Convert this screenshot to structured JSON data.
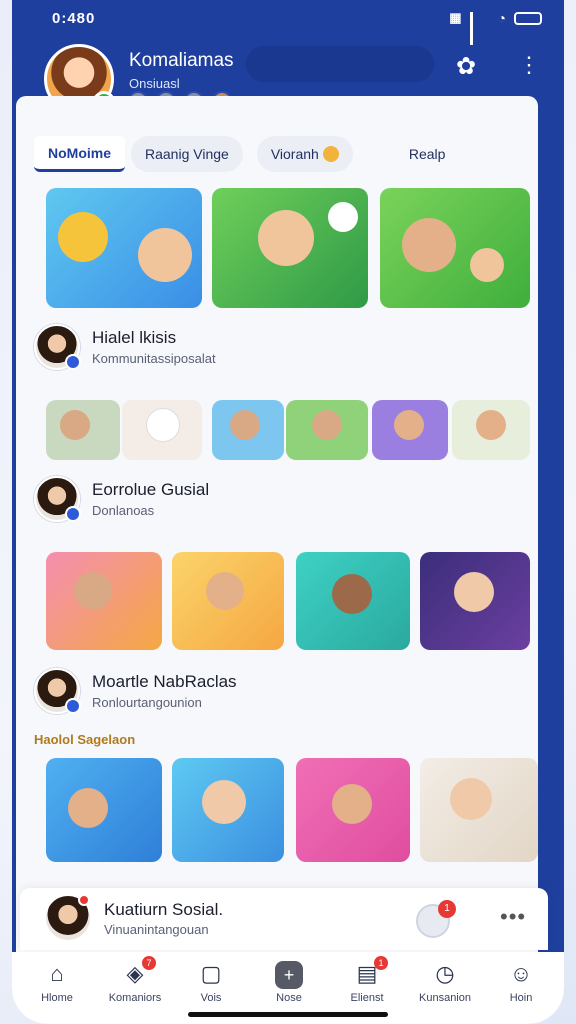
{
  "status_bar": {
    "time": "0:480"
  },
  "header": {
    "title": "Komaliamas",
    "subtitle": "Onsiuasl"
  },
  "tabs": [
    {
      "label": "NoMoime",
      "active": true
    },
    {
      "label": "Raanig Vinge",
      "active": false
    },
    {
      "label": "Vioranh",
      "active": false
    },
    {
      "label": "Realp",
      "active": false
    }
  ],
  "profiles": [
    {
      "name": "Hialel lkisis",
      "sub": "Kommunitassiposalat"
    },
    {
      "name": "Eorrolue Gusial",
      "sub": "Donlanoas"
    },
    {
      "name": "Moartle NabRaclas",
      "sub": "Ronlourtangounion"
    }
  ],
  "section_label": "Haolol Sagelaon",
  "bottom_card": {
    "name": "Kuatiurn Sosial.",
    "sub": "Vinuanintangouan",
    "badge": "1"
  },
  "nav": [
    {
      "label": "Hlome",
      "icon": "home-icon",
      "badge": ""
    },
    {
      "label": "Komaniors",
      "icon": "compass-icon",
      "badge": "7"
    },
    {
      "label": "Vois",
      "icon": "video-icon",
      "badge": ""
    },
    {
      "label": "Nose",
      "icon": "plus-icon",
      "badge": ""
    },
    {
      "label": "Elienst",
      "icon": "events-icon",
      "badge": "1"
    },
    {
      "label": "Kunsanion",
      "icon": "clock-icon",
      "badge": ""
    },
    {
      "label": "Hoin",
      "icon": "profile-icon",
      "badge": ""
    }
  ],
  "colors": {
    "brand": "#1f3f9e",
    "accent_red": "#e53935",
    "online_green": "#2db34a"
  }
}
